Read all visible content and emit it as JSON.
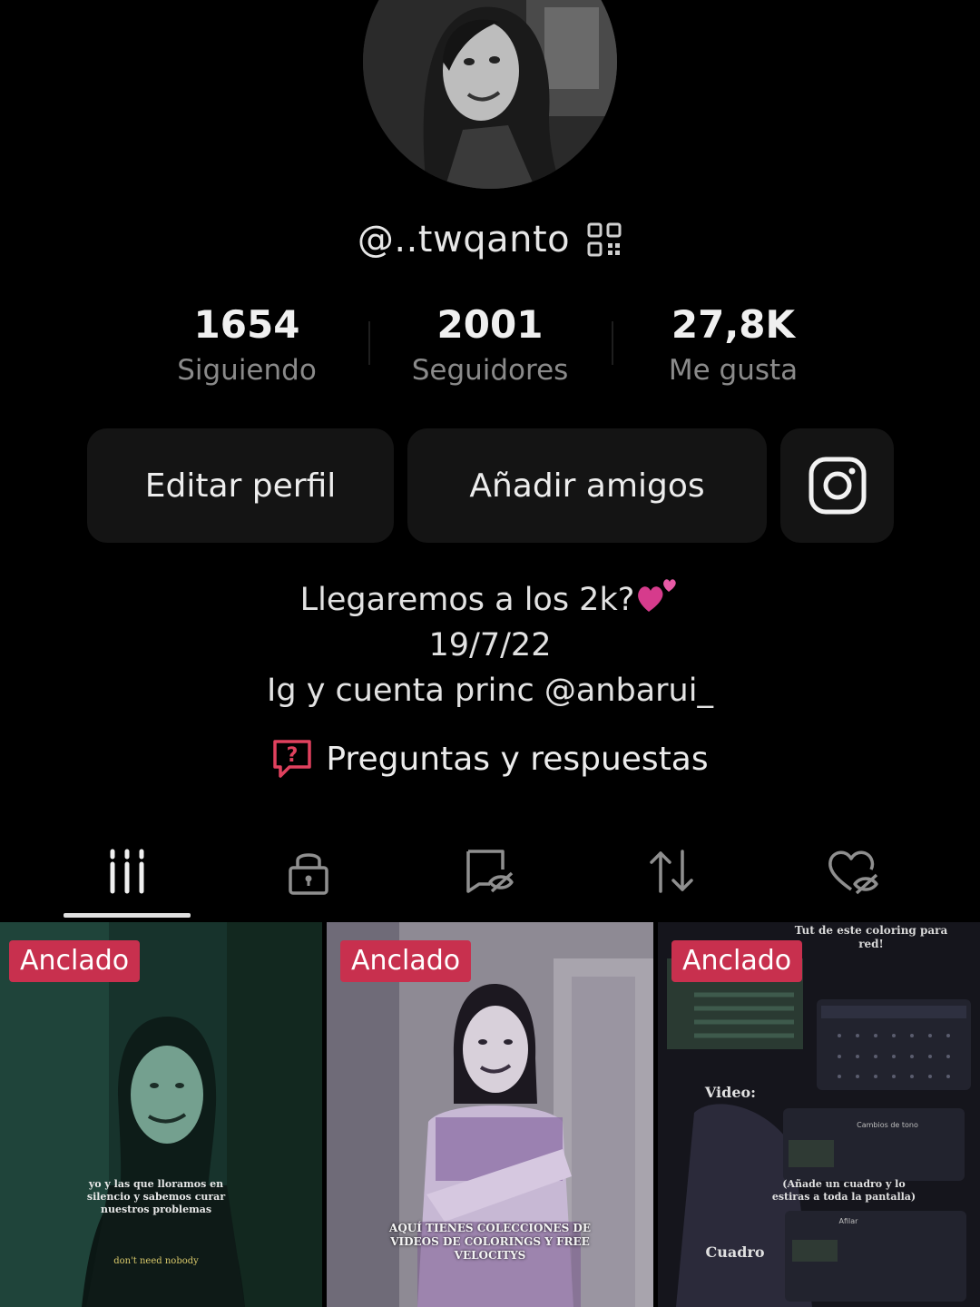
{
  "profile": {
    "username": "@..twqanto",
    "stats": [
      {
        "number": "1654",
        "label": "Siguiendo"
      },
      {
        "number": "2001",
        "label": "Seguidores"
      },
      {
        "number": "27,8K",
        "label": "Me gusta"
      }
    ]
  },
  "buttons": {
    "edit": "Editar perfil",
    "add_friends": "Añadir amigos"
  },
  "bio": {
    "line1": "Llegaremos a los 2k?",
    "line2": "19/7/22",
    "line3": "Ig y cuenta princ @anbarui_"
  },
  "qa": {
    "label": "Preguntas y respuestas"
  },
  "tabs": [
    {
      "icon": "grid-icon",
      "active": true
    },
    {
      "icon": "lock-icon",
      "active": false
    },
    {
      "icon": "bookmark-hidden-icon",
      "active": false
    },
    {
      "icon": "repost-icon",
      "active": false
    },
    {
      "icon": "heart-hidden-icon",
      "active": false
    }
  ],
  "videos": [
    {
      "badge": "Anclado",
      "caption": "yo y las que lloramos en silencio y sabemos curar nuestros problemas",
      "subcaption": "don't need nobody"
    },
    {
      "badge": "Anclado",
      "caption": "AQUÍ TIENES COLECCIONES DE VIDEOS DE COLORINGS Y FREE VELOCITYS"
    },
    {
      "badge": "Anclado",
      "caption_top": "Tut de este coloring para red!",
      "label_video": "Video:",
      "note": "(Añade un cuadro y lo estiras a toda la pantalla)",
      "label_cuadro": "Cuadro",
      "panel1": "Cambios de tono",
      "panel2": "Afilar"
    }
  ],
  "colors": {
    "background": "#000000",
    "button_bg": "#141414",
    "badge_red": "#c8304e",
    "muted_text": "#8a8a8a"
  }
}
